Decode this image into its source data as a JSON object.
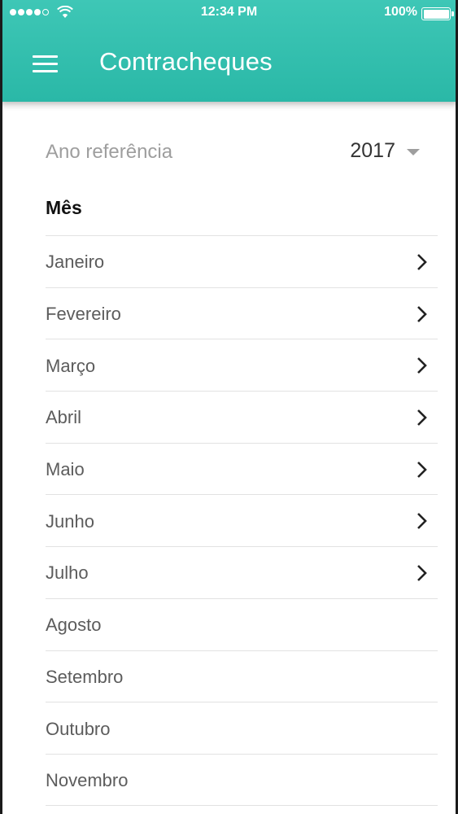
{
  "status_bar": {
    "time": "12:34 PM",
    "battery": "100%"
  },
  "app_bar": {
    "title": "Contracheques",
    "menu_icon": "hamburger-menu-icon"
  },
  "filter": {
    "label": "Ano referência",
    "year": "2017"
  },
  "section": {
    "heading": "Mês"
  },
  "months": [
    {
      "label": "Janeiro",
      "has_arrow": true
    },
    {
      "label": "Fevereiro",
      "has_arrow": true
    },
    {
      "label": "Março",
      "has_arrow": true
    },
    {
      "label": "Abril",
      "has_arrow": true
    },
    {
      "label": "Maio",
      "has_arrow": true
    },
    {
      "label": "Junho",
      "has_arrow": true
    },
    {
      "label": "Julho",
      "has_arrow": true
    },
    {
      "label": "Agosto",
      "has_arrow": false
    },
    {
      "label": "Setembro",
      "has_arrow": false
    },
    {
      "label": "Outubro",
      "has_arrow": false
    },
    {
      "label": "Novembro",
      "has_arrow": false
    }
  ],
  "colors": {
    "accent": "#2ab8a7",
    "text_muted": "#9e9e9e",
    "text_item": "#5c5c5c"
  }
}
